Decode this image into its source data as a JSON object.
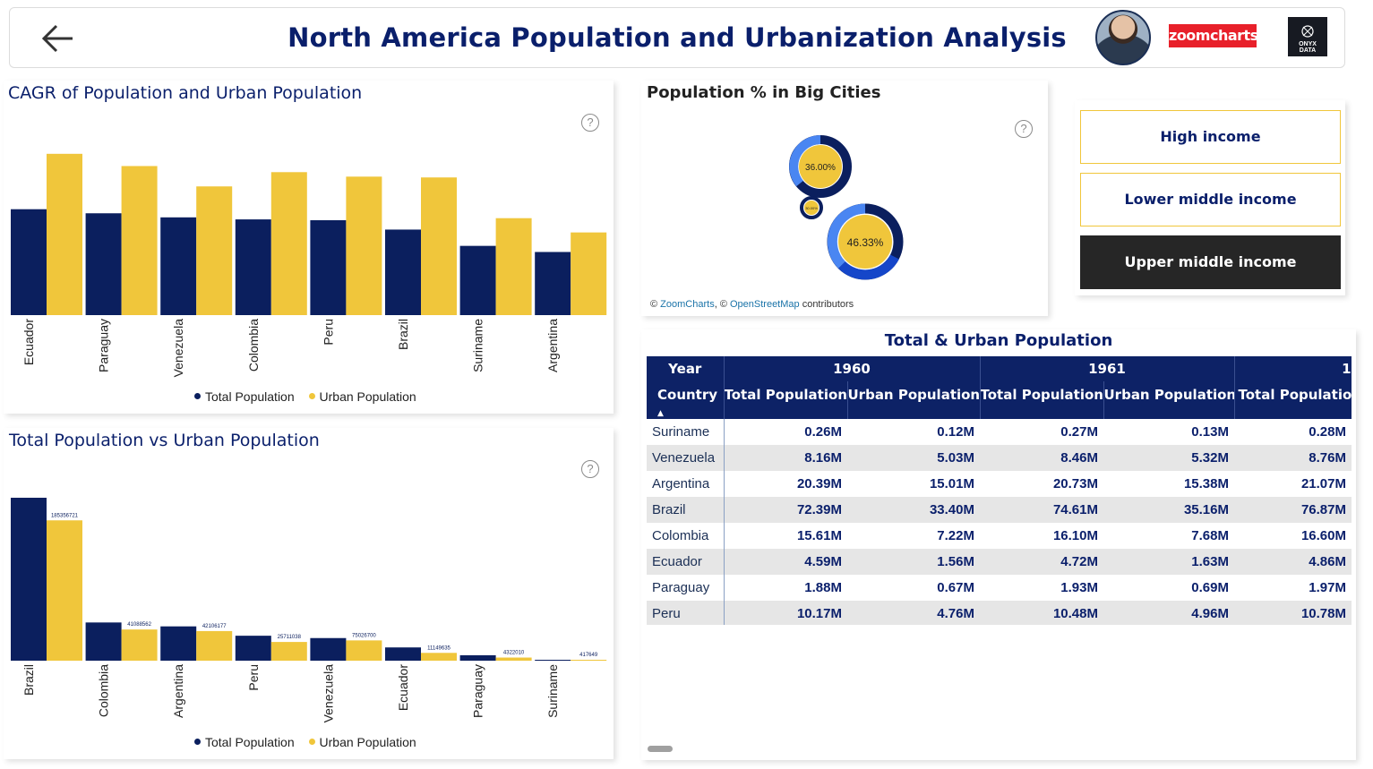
{
  "header": {
    "title": "North America Population and Urbanization Analysis",
    "zoom_logo": "zoomcharts",
    "onyx_logo_line1": "ONYX",
    "onyx_logo_line2": "DATA"
  },
  "colors": {
    "navy": "#0b1f5e",
    "gold": "#f0c63b",
    "title": "#0a1f6b"
  },
  "cagr_chart": {
    "title": "CAGR of Population and Urban Population",
    "legend": [
      "Total Population",
      "Urban Population"
    ]
  },
  "pop_chart": {
    "title": "Total Population vs Urban Population",
    "legend": [
      "Total Population",
      "Urban Population"
    ]
  },
  "big_cities": {
    "title": "Population % in Big Cities",
    "labels": [
      "36.00%",
      "30.00%",
      "46.33%"
    ],
    "attribution_prefix": "© ",
    "attribution_zc": "ZoomCharts",
    "attribution_mid": ", © ",
    "attribution_osm": "OpenStreetMap",
    "attribution_suffix": " contributors"
  },
  "slicers": [
    "High income",
    "Lower middle income",
    "Upper middle income"
  ],
  "slicer_selected": "Upper middle income",
  "table": {
    "title": "Total & Urban Population",
    "year_label": "Year",
    "country_label": "Country",
    "years": [
      "1960",
      "1961",
      "1"
    ],
    "columns": [
      "Total Population",
      "Urban Population",
      "Total Population",
      "Urban Population",
      "Total Population"
    ],
    "rows": [
      {
        "country": "Suriname",
        "values": [
          "0.26M",
          "0.12M",
          "0.27M",
          "0.13M",
          "0.28M"
        ]
      },
      {
        "country": "Venezuela",
        "values": [
          "8.16M",
          "5.03M",
          "8.46M",
          "5.32M",
          "8.76M"
        ]
      },
      {
        "country": "Argentina",
        "values": [
          "20.39M",
          "15.01M",
          "20.73M",
          "15.38M",
          "21.07M"
        ]
      },
      {
        "country": "Brazil",
        "values": [
          "72.39M",
          "33.40M",
          "74.61M",
          "35.16M",
          "76.87M"
        ]
      },
      {
        "country": "Colombia",
        "values": [
          "15.61M",
          "7.22M",
          "16.10M",
          "7.68M",
          "16.60M"
        ]
      },
      {
        "country": "Ecuador",
        "values": [
          "4.59M",
          "1.56M",
          "4.72M",
          "1.63M",
          "4.86M"
        ]
      },
      {
        "country": "Paraguay",
        "values": [
          "1.88M",
          "0.67M",
          "1.93M",
          "0.69M",
          "1.97M"
        ]
      },
      {
        "country": "Peru",
        "values": [
          "10.17M",
          "4.76M",
          "10.48M",
          "4.96M",
          "10.78M"
        ]
      }
    ]
  },
  "chart_data": [
    {
      "type": "bar",
      "title": "CAGR of Population and Urban Population",
      "categories": [
        "Ecuador",
        "Paraguay",
        "Venezuela",
        "Colombia",
        "Peru",
        "Brazil",
        "Suriname",
        "Argentina"
      ],
      "series": [
        {
          "name": "Total Population",
          "values": [
            2.6,
            2.5,
            2.4,
            2.35,
            2.33,
            2.1,
            1.7,
            1.55
          ]
        },
        {
          "name": "Urban Population",
          "values": [
            3.96,
            3.66,
            3.16,
            3.51,
            3.4,
            3.38,
            2.38,
            2.03
          ]
        }
      ],
      "ylim": [
        0,
        4
      ]
    },
    {
      "type": "bar",
      "title": "Total Population vs Urban Population",
      "categories": [
        "Brazil",
        "Colombia",
        "Argentina",
        "Peru",
        "Venezuela",
        "Ecuador",
        "Paraguay",
        "Suriname"
      ],
      "series": [
        {
          "name": "Total Population",
          "values": [
            209000000,
            49000000,
            44000000,
            32000000,
            29000000,
            17000000,
            7000000,
            580000
          ]
        },
        {
          "name": "Urban Population",
          "values": [
            180000000,
            40000000,
            38000000,
            24000000,
            26000000,
            10000000,
            4000000,
            360000
          ]
        }
      ],
      "data_labels": [
        "185356721",
        "41088562",
        "42106177",
        "25711038",
        "75026700",
        "11149635",
        "4322010",
        "417649"
      ],
      "ylim": [
        0,
        209000000
      ]
    }
  ]
}
